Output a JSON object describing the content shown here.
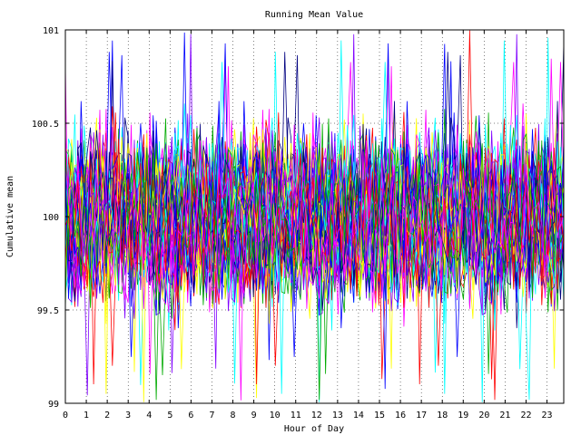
{
  "chart_data": {
    "type": "line",
    "title": "Running Mean Value",
    "xlabel": "Hour of Day",
    "ylabel": "Cumulative mean",
    "xlim": [
      0,
      23.8
    ],
    "ylim": [
      99,
      101
    ],
    "x_ticks": [
      "0",
      "1",
      "2",
      "3",
      "4",
      "5",
      "6",
      "7",
      "8",
      "9",
      "10",
      "11",
      "12",
      "13",
      "14",
      "15",
      "16",
      "17",
      "18",
      "19",
      "20",
      "21",
      "22",
      "23"
    ],
    "y_ticks": [
      "99",
      "99.5",
      "100",
      "100.5",
      "101"
    ],
    "grid": true,
    "legend": "none",
    "colors": [
      "#0000ff",
      "#ff0000",
      "#00aa00",
      "#ff00ff",
      "#00ffff",
      "#ffff00",
      "#8000ff",
      "#000080"
    ],
    "series_description": {
      "count": 60,
      "points_per_series": 160,
      "center": 100.0,
      "typical_band": [
        99.55,
        100.45
      ],
      "extreme_low": 99.0,
      "extreme_high": 101.0
    }
  }
}
